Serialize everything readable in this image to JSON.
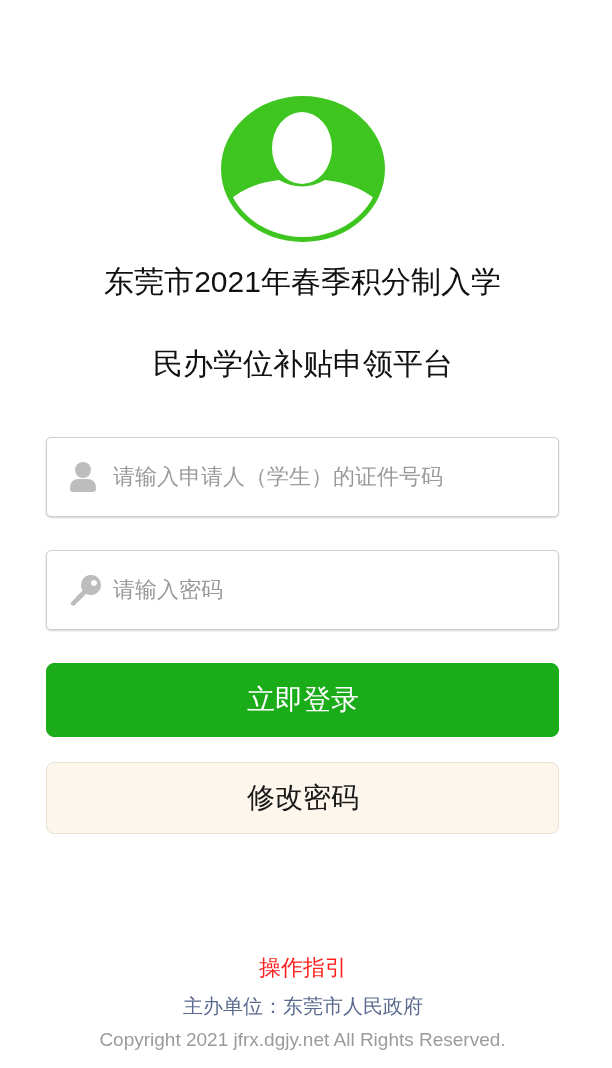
{
  "title_lines": [
    "东莞市2021年春季积分制入学",
    "民办学位补贴申领平台"
  ],
  "fields": [
    {
      "kind": "id",
      "placeholder": "请输入申请人（学生）的证件号码"
    },
    {
      "kind": "password",
      "placeholder": "请输入密码"
    }
  ],
  "buttons": [
    {
      "kind": "primary",
      "label": "立即登录"
    },
    {
      "kind": "secondary",
      "label": "修改密码"
    }
  ],
  "footer": {
    "guide_link": "操作指引",
    "organizer": "主办单位：东莞市人民政府",
    "copyright": "Copyright 2021 jfrx.dgjy.net All Rights Reserved."
  }
}
